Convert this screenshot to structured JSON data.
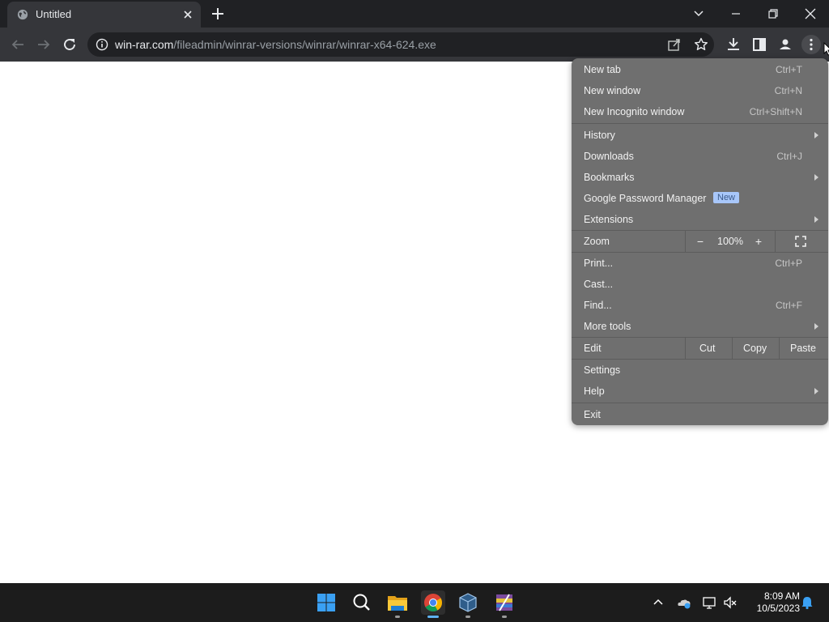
{
  "tab": {
    "title": "Untitled",
    "favicon": "globe-icon",
    "close_icon": "close-icon"
  },
  "window": {
    "tab_search_icon": "chevron-down-icon",
    "minimize_icon": "minimize-icon",
    "restore_icon": "restore-icon",
    "close_icon": "close-icon"
  },
  "toolbar": {
    "back_icon": "back-arrow-icon",
    "forward_icon": "forward-arrow-icon",
    "reload_icon": "reload-icon",
    "url_host": "win-rar.com",
    "url_path": "/fileadmin/winrar-versions/winrar/winrar-x64-624.exe",
    "site_info_icon": "info-icon",
    "share_icon": "share-icon",
    "bookmark_icon": "star-icon",
    "downloads_icon": "download-icon",
    "side_panel_icon": "side-panel-icon",
    "profile_icon": "profile-icon",
    "menu_icon": "kebab-menu-icon"
  },
  "menu": {
    "new_tab": {
      "label": "New tab",
      "shortcut": "Ctrl+T"
    },
    "new_window": {
      "label": "New window",
      "shortcut": "Ctrl+N"
    },
    "new_incognito": {
      "label": "New Incognito window",
      "shortcut": "Ctrl+Shift+N"
    },
    "history": {
      "label": "History"
    },
    "downloads": {
      "label": "Downloads",
      "shortcut": "Ctrl+J"
    },
    "bookmarks": {
      "label": "Bookmarks"
    },
    "password_manager": {
      "label": "Google Password Manager",
      "badge": "New"
    },
    "extensions": {
      "label": "Extensions"
    },
    "zoom": {
      "label": "Zoom",
      "minus": "−",
      "value": "100%",
      "plus": "+",
      "fullscreen_icon": "fullscreen-icon"
    },
    "print": {
      "label": "Print...",
      "shortcut": "Ctrl+P"
    },
    "cast": {
      "label": "Cast..."
    },
    "find": {
      "label": "Find...",
      "shortcut": "Ctrl+F"
    },
    "more_tools": {
      "label": "More tools"
    },
    "edit": {
      "label": "Edit",
      "cut": "Cut",
      "copy": "Copy",
      "paste": "Paste"
    },
    "settings": {
      "label": "Settings"
    },
    "help": {
      "label": "Help"
    },
    "exit": {
      "label": "Exit"
    }
  },
  "taskbar": {
    "apps": [
      "windows-start-icon",
      "search-icon",
      "file-explorer-icon",
      "chrome-icon",
      "virtualbox-icon",
      "winrar-icon"
    ],
    "tray": [
      "chevron-up-icon",
      "onedrive-icon",
      "network-icon",
      "speaker-muted-icon",
      "notification-bell-icon"
    ],
    "time": "8:09 AM",
    "date": "10/5/2023"
  },
  "colors": {
    "tabstrip": "#202124",
    "toolbar": "#35363a",
    "menu": "#6f6f6f",
    "badge": "#a8c7fa",
    "taskbar": "#1c1c1c"
  }
}
